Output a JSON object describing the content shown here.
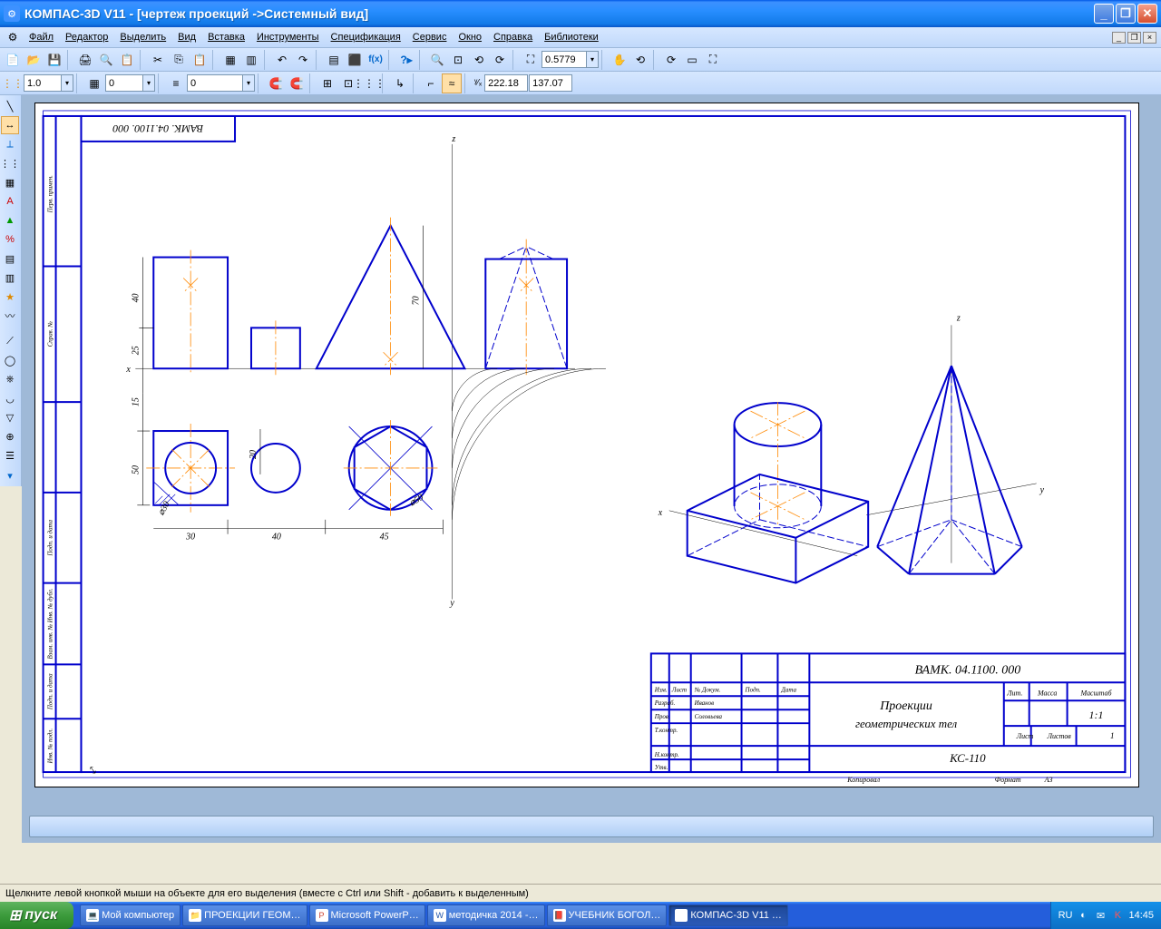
{
  "titlebar": {
    "app": "КОМПАС-3D V11 - [чертеж проекций ->Системный вид]"
  },
  "menu": {
    "file": "Файл",
    "edit": "Редактор",
    "select": "Выделить",
    "view": "Вид",
    "insert": "Вставка",
    "tools": "Инструменты",
    "spec": "Спецификация",
    "service": "Сервис",
    "window": "Окно",
    "help": "Справка",
    "lib": "Библиотеки"
  },
  "toolbar1": {
    "zoom_value": "0.5779"
  },
  "toolbar2": {
    "step": "1.0",
    "field2": "0",
    "field3": "0",
    "coord_x": "222.18",
    "coord_y": "137.07"
  },
  "drawing": {
    "frame_code_top": "ВАМК. 04.1100. 000",
    "axes": {
      "x": "x",
      "y": "y",
      "z": "z"
    },
    "dims": {
      "d30": "30",
      "d40": "40",
      "d45": "45",
      "d50v": "50",
      "d15": "15",
      "d20": "20",
      "d25": "25",
      "d40v": "40",
      "d70": "70",
      "diam30": "⌀30",
      "diam50": "⌀50"
    },
    "stamp": {
      "code": "ВАМК. 04.1100. 000",
      "title1": "Проекции",
      "title2": "геометрических тел",
      "group": "КС-110",
      "lit": "Лит.",
      "mass": "Масса",
      "scale_h": "Масштаб",
      "scale": "1:1",
      "list": "Лист",
      "listov": "Листов",
      "listov_n": "1",
      "izm": "Изм.",
      "list_h": "Лист",
      "ndoc": "№ Докум.",
      "podp": "Подп.",
      "data": "Дата",
      "razrab": "Разраб.",
      "razrab_n": "Иванов",
      "prov": "Пров.",
      "prov_n": "Соловьева",
      "tkontr": "Т.контр.",
      "nkontr": "Н.контр.",
      "utv": "Утв.",
      "kopiroval": "Копировал",
      "format": "Формат",
      "format_v": "А3"
    },
    "side_labels": {
      "perv": "Перв. примен.",
      "sprav": "Справ. №",
      "podp_data1": "Подп. и дата",
      "inv_dubl": "Взам. инв. № Инв. № дубл.",
      "podp_data2": "Подп. и дата",
      "inv_podl": "Инв. № подл."
    }
  },
  "status": {
    "hint": "Щелкните левой кнопкой мыши на объекте для его выделения (вместе с Ctrl или Shift - добавить к выделенным)"
  },
  "taskbar": {
    "start": "пуск",
    "tasks": [
      "Мой компьютер",
      "ПРОЕКЦИИ ГЕОМ…",
      "Microsoft PowerP…",
      "методичка 2014 -…",
      "УЧЕБНИК БОГОЛ…",
      "КОМПАС-3D V11 …"
    ],
    "lang": "RU",
    "time": "14:45"
  }
}
